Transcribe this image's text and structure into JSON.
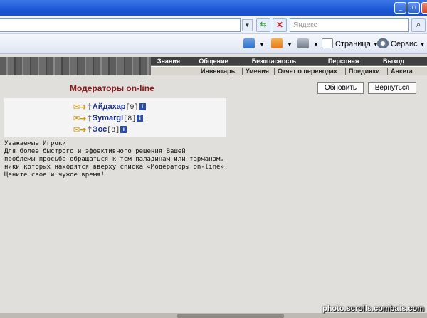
{
  "address_bar": {
    "search_placeholder": "Яндекс"
  },
  "command_bar": {
    "page_label": "Страница",
    "tools_label": "Сервис"
  },
  "game_nav": {
    "main_items": [
      "Знания",
      "Общение",
      "Безопасность",
      "Персонаж",
      "Выход"
    ],
    "sub_items": [
      "Инвентарь",
      "Умения",
      "Отчет о переводах",
      "Поединки",
      "Анкета"
    ]
  },
  "page": {
    "title": "Модераторы on-line",
    "refresh_label": "Обновить",
    "back_label": "Вернуться"
  },
  "moderators": [
    {
      "nick": "Айдахар",
      "level": "[9]"
    },
    {
      "nick": "Symargl",
      "level": "[8]"
    },
    {
      "nick": "Эос",
      "level": "[8]"
    }
  ],
  "notice_lines": [
    "Уважаемые Игроки!",
    "Для более быстрого и эффективного решения Вашей",
    "проблемы просьба обращаться к тем паладинам или тарманам,",
    "ники которых находятся вверху списка «Модераторы on-line».",
    "Цените свое и чужое время!"
  ],
  "watermark": "photo.scrolls.combats.com",
  "icons": {
    "info": "i",
    "cross": "†"
  }
}
